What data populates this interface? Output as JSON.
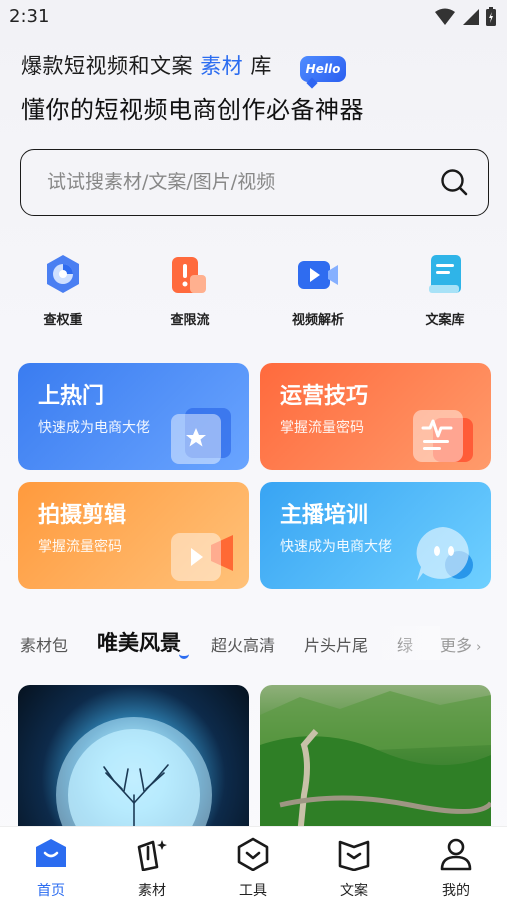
{
  "status_bar": {
    "time": "2:31"
  },
  "header": {
    "line1_pre": "爆款短视频和文案",
    "line1_accent": "素材",
    "line1_post": "库",
    "hello_badge": "Hello",
    "line2": "懂你的短视频电商创作必备神器"
  },
  "search": {
    "placeholder": "试试搜素材/文案/图片/视频"
  },
  "tools": [
    {
      "label": "查权重",
      "icon": "pie-chart-icon"
    },
    {
      "label": "查限流",
      "icon": "alert-icon"
    },
    {
      "label": "视频解析",
      "icon": "video-camera-icon"
    },
    {
      "label": "文案库",
      "icon": "book-icon"
    }
  ],
  "cards": [
    {
      "title": "上热门",
      "subtitle": "快速成为电商大佬",
      "color": "#3a7cf0"
    },
    {
      "title": "运营技巧",
      "subtitle": "掌握流量密码",
      "color": "#ff6a3d"
    },
    {
      "title": "拍摄剪辑",
      "subtitle": "掌握流量密码",
      "color": "#ff9a3d"
    },
    {
      "title": "主播培训",
      "subtitle": "快速成为电商大佬",
      "color": "#38a4f3"
    }
  ],
  "category_tabs": [
    "素材包",
    "唯美风景",
    "超火高清",
    "片头片尾",
    "绿"
  ],
  "active_tab": "唯美风景",
  "more_label": "更多",
  "bottom_nav": [
    {
      "label": "首页",
      "icon": "home-icon",
      "active": true
    },
    {
      "label": "素材",
      "icon": "material-icon",
      "active": false
    },
    {
      "label": "工具",
      "icon": "tool-icon",
      "active": false
    },
    {
      "label": "文案",
      "icon": "document-icon",
      "active": false
    },
    {
      "label": "我的",
      "icon": "profile-icon",
      "active": false
    }
  ],
  "colors": {
    "accent": "#2b6cf0"
  }
}
